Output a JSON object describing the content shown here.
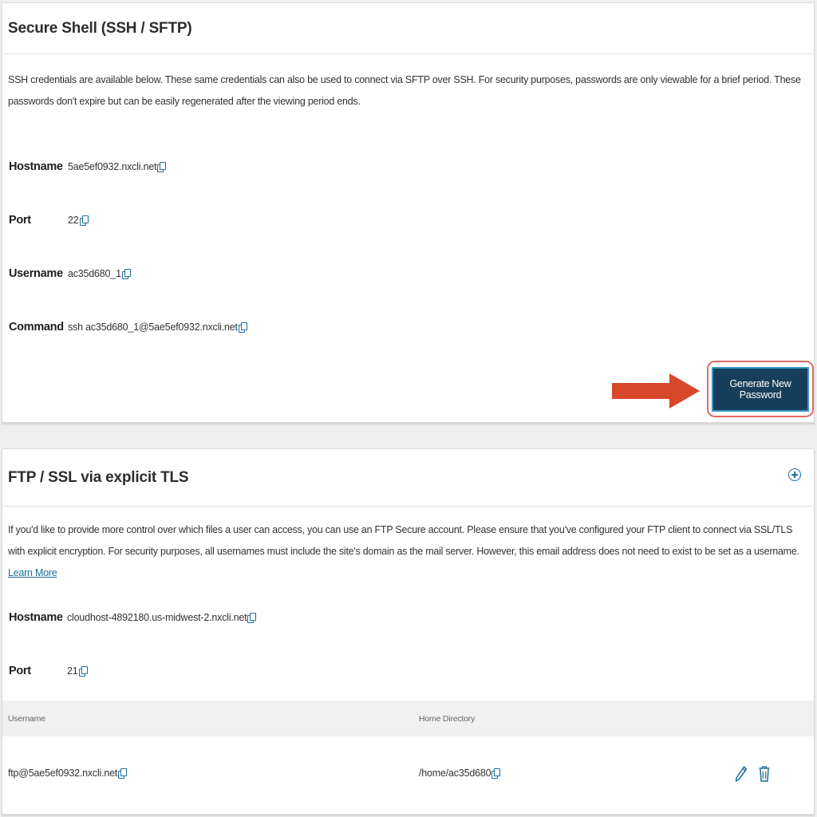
{
  "ssh": {
    "title": "Secure Shell (SSH / SFTP)",
    "description": "SSH credentials are available below. These same credentials can also be used to connect via SFTP over SSH. For security purposes, passwords are only viewable for a brief period. These passwords don't expire but can be easily regenerated after the viewing period ends.",
    "fields": [
      {
        "label": "Hostname",
        "value": "5ae5ef0932.nxcli.net"
      },
      {
        "label": "Port",
        "value": "22"
      },
      {
        "label": "Username",
        "value": "ac35d680_1"
      },
      {
        "label": "Command",
        "value": "ssh ac35d680_1@5ae5ef0932.nxcli.net"
      }
    ],
    "generate_button": "Generate New Password"
  },
  "ftp": {
    "title": "FTP / SSL via explicit TLS",
    "description": "If you'd like to provide more control over which files a user can access, you can use an FTP Secure account. Please ensure that you've configured your FTP client to connect via SSL/TLS with explicit encryption. For security purposes, all usernames must include the site's domain as the mail server. However, this email address does not need to exist to be set as a username.",
    "learn_more": "Learn More",
    "fields": [
      {
        "label": "Hostname",
        "value": "cloudhost-4892180.us-midwest-2.nxcli.net"
      },
      {
        "label": "Port",
        "value": "21"
      }
    ],
    "table": {
      "headers": [
        "Username",
        "Home Directory"
      ],
      "rows": [
        {
          "username": "ftp@5ae5ef0932.nxcli.net",
          "home_directory": "/home/ac35d680"
        }
      ]
    }
  },
  "icons": {
    "copy": "copy-icon",
    "add": "plus-circle-icon",
    "edit": "pencil-icon",
    "delete": "trash-icon"
  },
  "colors": {
    "accent": "#1a6d9a",
    "button_bg": "#173e5a",
    "highlight": "#e16b6b",
    "arrow": "#d9472b"
  }
}
